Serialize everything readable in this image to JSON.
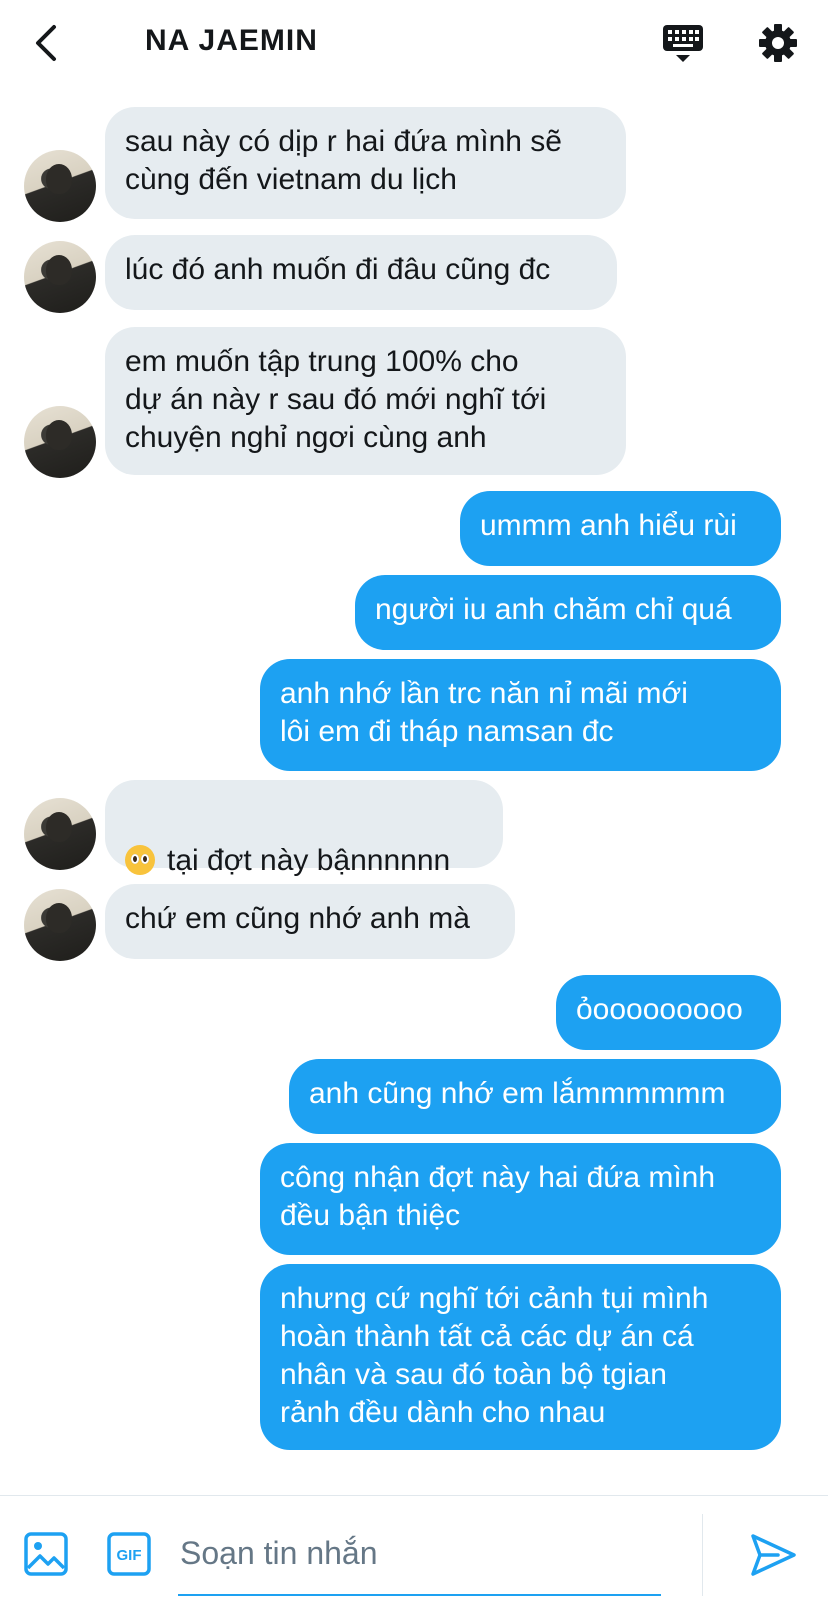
{
  "header": {
    "title": "NA JAEMIN",
    "back_icon": "chevron-left-icon",
    "keyboard_icon": "keyboard-icon",
    "settings_icon": "gear-icon"
  },
  "messages": [
    {
      "direction": "incoming",
      "text": "sau này có dịp r hai đứa mình sẽ\ncùng đến vietnam du lịch"
    },
    {
      "direction": "incoming",
      "text": "lúc đó anh muốn đi đâu cũng đc"
    },
    {
      "direction": "incoming",
      "text": "em muốn tập trung 100% cho\ndự án này r sau đó mới nghĩ tới\nchuyện nghỉ ngơi cùng anh"
    },
    {
      "direction": "outgoing",
      "text": "ummm anh hiểu rùi"
    },
    {
      "direction": "outgoing",
      "text": "người iu anh chăm chỉ quá"
    },
    {
      "direction": "outgoing",
      "text": "anh nhớ lần trc năn nỉ mãi mới\nlôi em đi tháp namsan đc"
    },
    {
      "direction": "incoming",
      "emoji": "pleading-face-icon",
      "text": "tại đợt này bậnnnnnn"
    },
    {
      "direction": "incoming",
      "text": "chứ em cũng nhớ anh mà"
    },
    {
      "direction": "outgoing",
      "text": "ỏooooooooo"
    },
    {
      "direction": "outgoing",
      "text": "anh cũng nhớ em lắmmmmmm"
    },
    {
      "direction": "outgoing",
      "text": "công nhận đợt này hai đứa mình\nđều bận thiệc"
    },
    {
      "direction": "outgoing",
      "text": "nhưng cứ nghĩ tới cảnh tụi mình\nhoàn thành tất cả các dự án cá\nnhân và sau đó toàn bộ tgian\nrảnh đều dành cho nhau"
    }
  ],
  "compose": {
    "placeholder": "Soạn tin nhắn",
    "value": "",
    "image_icon": "image-icon",
    "gif_label": "GIF",
    "send_icon": "send-icon"
  },
  "colors": {
    "accent": "#1da1f2",
    "incoming_bubble": "#e6ecf0",
    "text": "#14171a",
    "placeholder": "#657786"
  }
}
